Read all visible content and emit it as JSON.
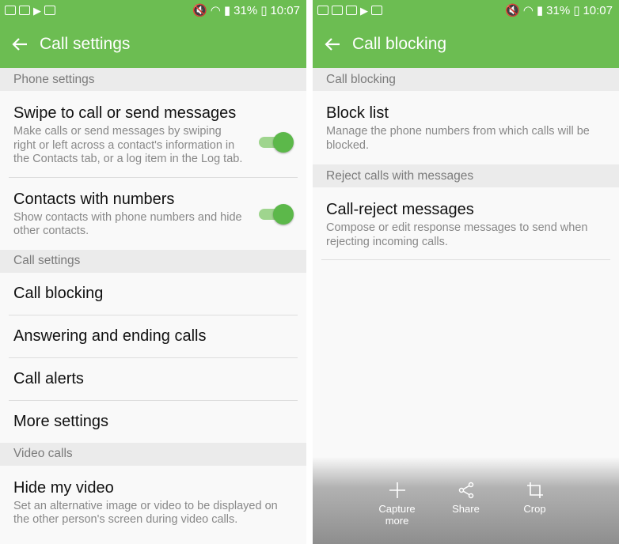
{
  "status_bar": {
    "battery": "31%",
    "time": "10:07"
  },
  "left": {
    "title": "Call settings",
    "phone_settings_header": "Phone settings",
    "swipe": {
      "title": "Swipe to call or send messages",
      "subtitle": "Make calls or send messages by swiping right or left across a contact's information in the Contacts tab, or a log item in the Log tab.",
      "enabled": true
    },
    "contacts": {
      "title": "Contacts with numbers",
      "subtitle": "Show contacts with phone numbers and hide other contacts.",
      "enabled": true
    },
    "call_settings_header": "Call settings",
    "items": [
      "Call blocking",
      "Answering and ending calls",
      "Call alerts",
      "More settings"
    ],
    "video_calls_header": "Video calls",
    "hide_video": {
      "title": "Hide my video",
      "subtitle": "Set an alternative image or video to be displayed on the other person's screen during video calls."
    }
  },
  "right": {
    "title": "Call blocking",
    "call_blocking_header": "Call blocking",
    "block_list": {
      "title": "Block list",
      "subtitle": "Manage the phone numbers from which calls will be blocked."
    },
    "reject_header": "Reject calls with messages",
    "reject_messages": {
      "title": "Call-reject messages",
      "subtitle": "Compose or edit response messages to send when rejecting incoming calls."
    },
    "capture": {
      "capture_more": "Capture more",
      "share": "Share",
      "crop": "Crop"
    }
  },
  "colors": {
    "accent": "#6cbd52",
    "toggle_on": "#5cb84a"
  }
}
